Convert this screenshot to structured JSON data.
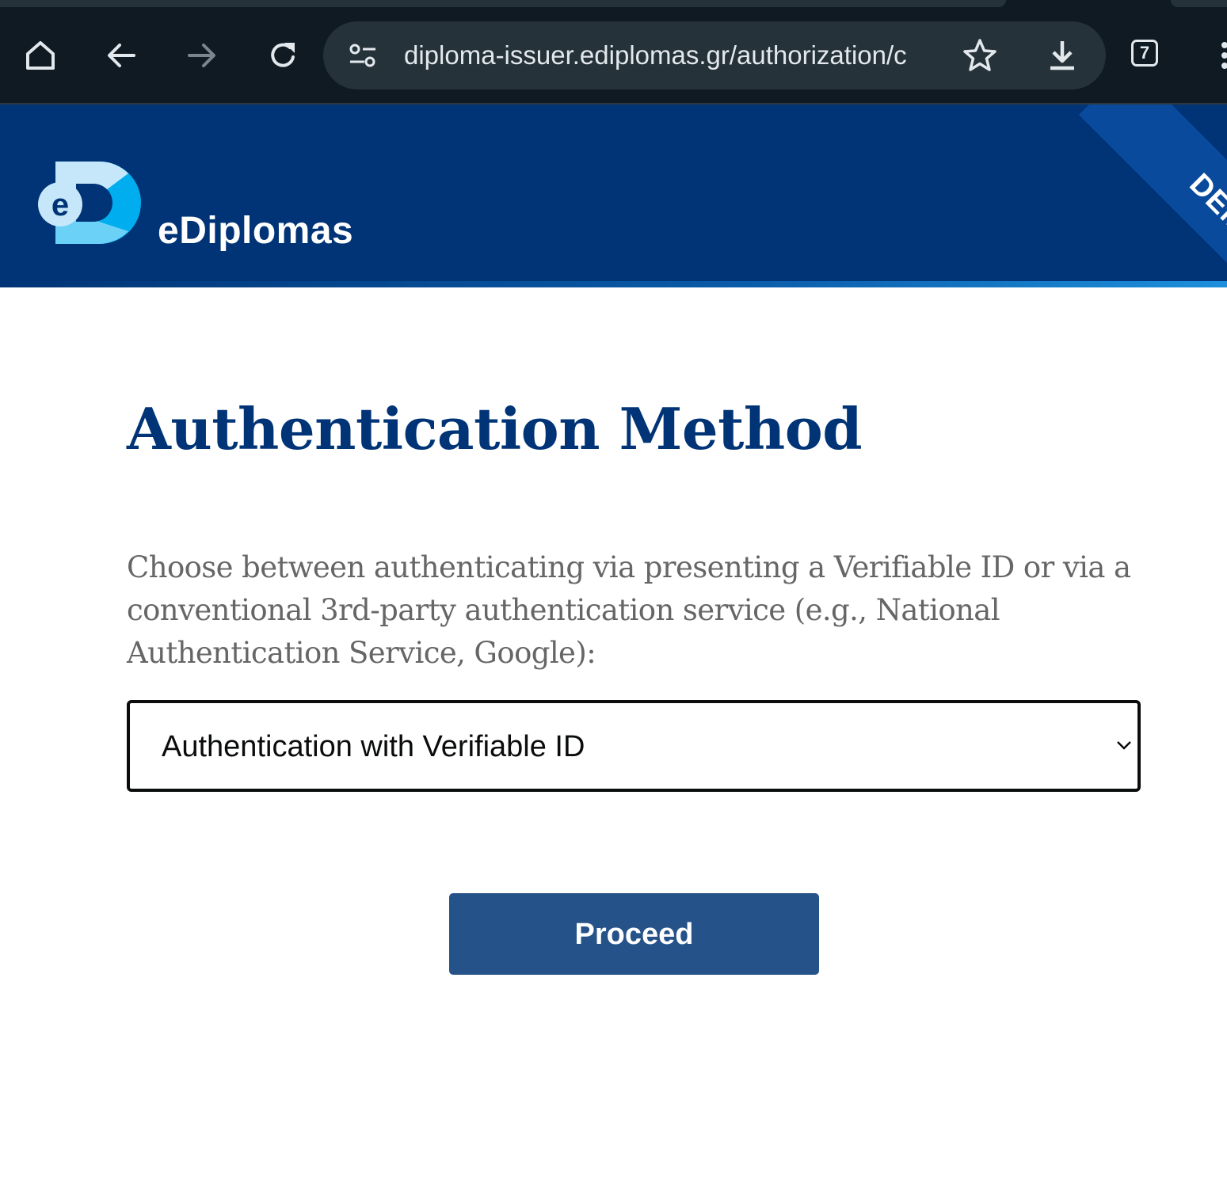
{
  "browser": {
    "url": "diploma-issuer.ediplomas.gr/authorization/c",
    "tab_count": "7",
    "icons": [
      "home-icon",
      "back-icon",
      "forward-icon",
      "reload-icon",
      "site-settings-icon",
      "bookmark-star-icon",
      "download-icon",
      "tab-switcher-icon",
      "menu-icon"
    ]
  },
  "header": {
    "logo_letter": "e",
    "brand": "eDiplomas",
    "ribbon": "DEMO",
    "colors": {
      "primary": "#003476",
      "logo_light": "#c6e7fa",
      "logo_accent": "#00aeef"
    }
  },
  "main": {
    "title": "Authentication Method",
    "description": "Choose between authenticating via presenting a Verifiable ID or via a conventional 3rd-party authentication service (e.g., National Authentication Service, Google):",
    "select": {
      "value": "Authentication with Verifiable ID"
    },
    "proceed_label": "Proceed",
    "button_color": "#255288"
  }
}
